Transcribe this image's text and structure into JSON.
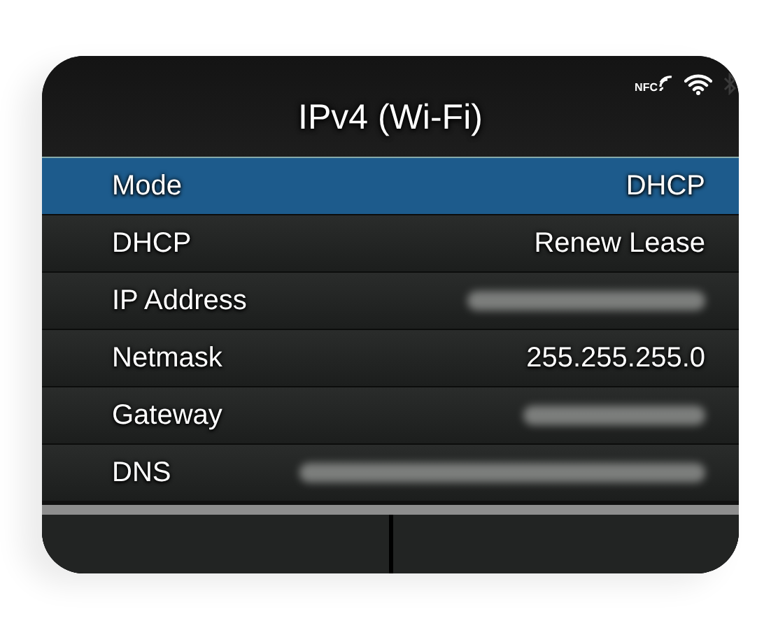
{
  "status": {
    "nfc_label": "NFC",
    "wifi_connected": true,
    "bluetooth_connected": false
  },
  "title": "IPv4 (Wi-Fi)",
  "rows": [
    {
      "label": "Mode",
      "kind": "text",
      "value": "DHCP",
      "selected": true
    },
    {
      "label": "DHCP",
      "kind": "text",
      "value": "Renew Lease",
      "selected": false
    },
    {
      "label": "IP Address",
      "kind": "blurred",
      "selected": false
    },
    {
      "label": "Netmask",
      "kind": "text",
      "value": "255.255.255.0",
      "selected": false
    },
    {
      "label": "Gateway",
      "kind": "blurred",
      "selected": false
    },
    {
      "label": "DNS",
      "kind": "blurred",
      "selected": false
    }
  ]
}
